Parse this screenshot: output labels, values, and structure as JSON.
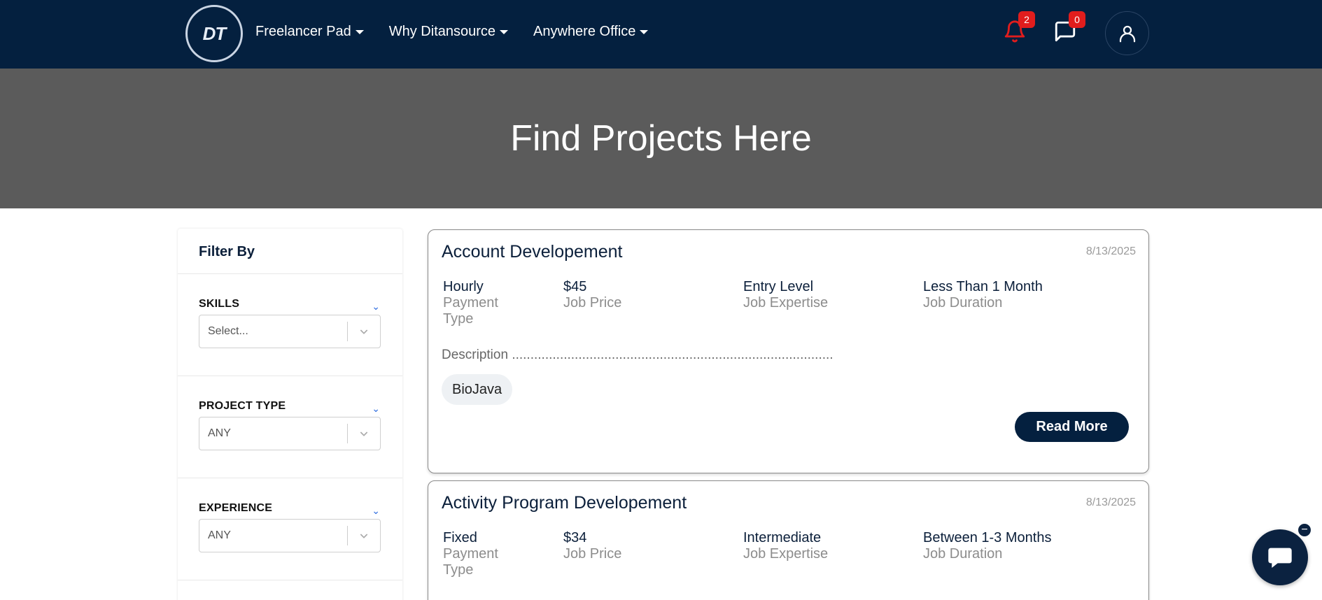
{
  "navbar": {
    "logo_text": "DT",
    "menu": [
      {
        "label": "Freelancer Pad"
      },
      {
        "label": "Why Ditansource"
      },
      {
        "label": "Anywhere Office"
      }
    ],
    "notifications_count": "2",
    "messages_count": "0",
    "notification_color": "#e11d1d"
  },
  "hero": {
    "title": "Find Projects Here"
  },
  "sidebar": {
    "heading": "Filter By",
    "filters": [
      {
        "label": "SKILLS",
        "value": "Select..."
      },
      {
        "label": "PROJECT TYPE",
        "value": "ANY"
      },
      {
        "label": "EXPERIENCE",
        "value": "ANY"
      }
    ]
  },
  "projects": [
    {
      "title": "Account Developement",
      "date": "8/13/2025",
      "payment_type": "Hourly",
      "payment_type_label": "Payment Type",
      "price": "$45",
      "price_label": "Job Price",
      "expertise": "Entry Level",
      "expertise_label": "Job Expertise",
      "duration": "Less Than 1 Month",
      "duration_label": "Job Duration",
      "description": "Description .......................................................................................",
      "tag": "BioJava",
      "read_more": "Read More"
    },
    {
      "title": "Activity Program Developement",
      "date": "8/13/2025",
      "payment_type": "Fixed",
      "payment_type_label": "Payment Type",
      "price": "$34",
      "price_label": "Job Price",
      "expertise": "Intermediate",
      "expertise_label": "Job Expertise",
      "duration": "Between 1-3 Months",
      "duration_label": "Job Duration"
    }
  ],
  "chat_widget": {
    "minimize_symbol": "−"
  },
  "colors": {
    "navy": "#04203f",
    "hero_bg": "#5b5b5b",
    "accent_blue": "#2d6cdf"
  }
}
